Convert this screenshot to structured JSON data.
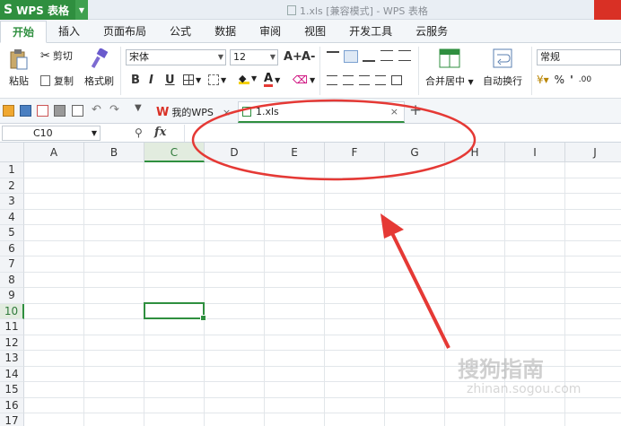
{
  "app": {
    "name": "WPS 表格"
  },
  "window": {
    "title": "1.xls [兼容模式] - WPS 表格"
  },
  "tabs": [
    "开始",
    "插入",
    "页面布局",
    "公式",
    "数据",
    "审阅",
    "视图",
    "开发工具",
    "云服务"
  ],
  "ribbon": {
    "paste": "粘贴",
    "cut": "剪切",
    "copy": "复制",
    "format_painter": "格式刷",
    "font_name": "宋体",
    "font_size": "12",
    "bold": "B",
    "italic": "I",
    "underline": "U",
    "merge_center": "合并居中",
    "wrap_text": "自动换行",
    "number_format": "常规",
    "percent": "%",
    "comma": "'",
    "decimals": ".00",
    "font_grow": "A+",
    "font_shrink": "A-"
  },
  "doc_tabs": [
    {
      "label": "我的WPS",
      "close": "×"
    },
    {
      "label": "1.xls",
      "close": "×"
    }
  ],
  "doc_tabs_add": "+",
  "formula_bar": {
    "cell_ref": "C10",
    "fx": "fx",
    "value": ""
  },
  "columns": [
    "A",
    "B",
    "C",
    "D",
    "E",
    "F",
    "G",
    "H",
    "I",
    "J"
  ],
  "rows": [
    "1",
    "2",
    "3",
    "4",
    "5",
    "6",
    "7",
    "8",
    "9",
    "10",
    "11",
    "12",
    "13",
    "14",
    "15",
    "16",
    "17"
  ],
  "selected_cell": "C10",
  "watermark": {
    "text": "搜狗指南",
    "url": "zhinan.sogou.com"
  },
  "colors": {
    "accent": "#2f8f3f",
    "annotation": "#e53935"
  }
}
